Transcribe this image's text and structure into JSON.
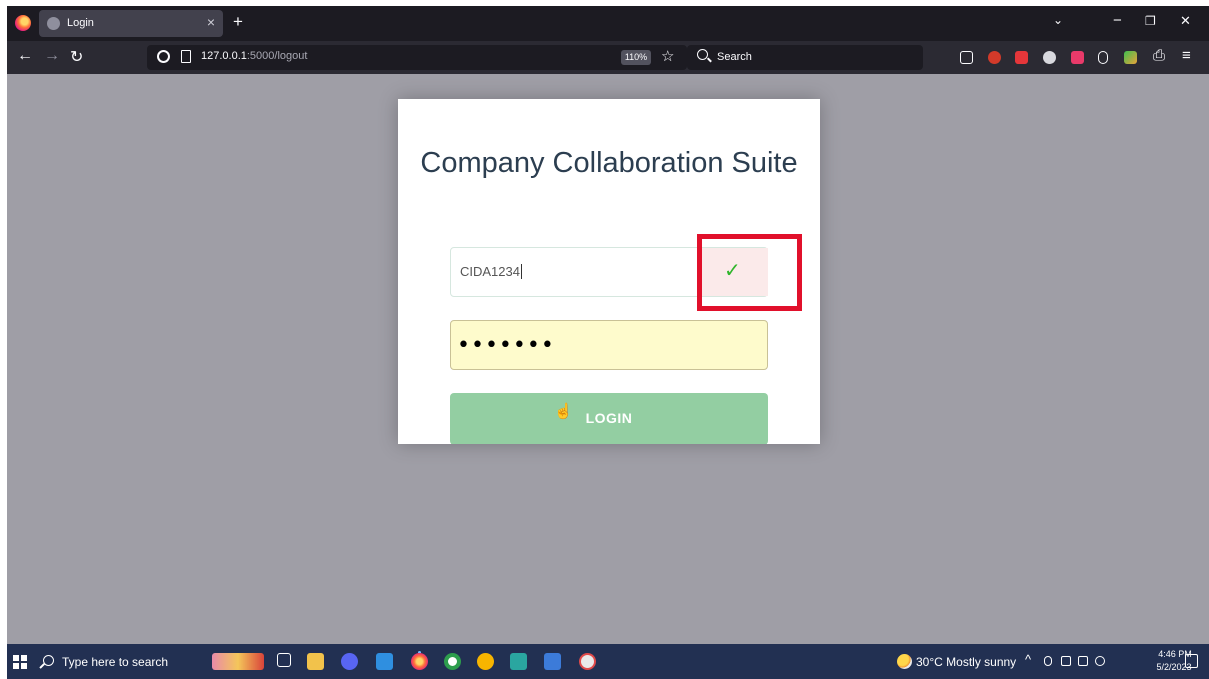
{
  "browser": {
    "tab_title": "Login",
    "tab_close": "×",
    "new_tab": "+",
    "url_host": "127.0.0.1",
    "url_path": ":5000/logout",
    "zoom": "110%",
    "search_placeholder": "Search",
    "window_controls": {
      "minimize": "−",
      "restore": "❐",
      "close": "✕"
    },
    "nav": {
      "back": "←",
      "forward": "→",
      "reload": "↻"
    }
  },
  "page": {
    "title": "Company Collaboration Suite",
    "username_value": "CIDA1234",
    "password_mask": "•••••••",
    "check_glyph": "✓",
    "login_label": "LOGIN",
    "cursor_glyph": "☝"
  },
  "colors": {
    "highlight_box": "#e1102b",
    "check": "#2fb52b",
    "login_button": "#93cea2",
    "page_bg": "#9f9ea6"
  },
  "taskbar": {
    "search_placeholder": "Type here to search",
    "weather": "30°C  Mostly sunny",
    "time": "4:46 PM",
    "date": "5/2/2023",
    "tray_chevron": "^"
  }
}
